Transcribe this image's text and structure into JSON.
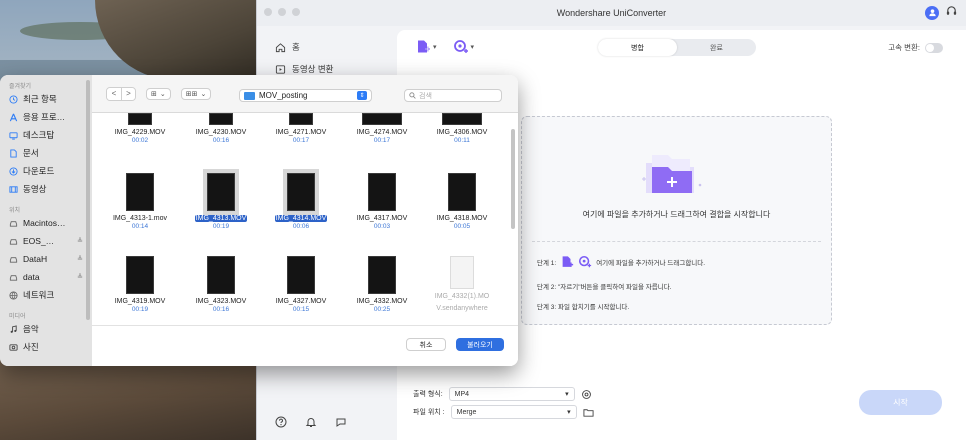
{
  "app": {
    "title": "Wondershare UniConverter",
    "sidebar": [
      {
        "label": "홈",
        "icon": "home-icon"
      },
      {
        "label": "동영상 변환",
        "icon": "convert-icon"
      }
    ],
    "bottom_icons": [
      "help-icon",
      "bell-icon",
      "feedback-icon"
    ],
    "toolbar": {
      "add_file_icon": "add-file-icon",
      "add_media_icon": "add-media-icon",
      "segments": [
        "병합",
        "완료"
      ],
      "active_segment": "병합",
      "speed_label": "고속 변환:"
    },
    "dropzone": {
      "main_text": "여기에 파일을 추가하거나 드래그하여 결합을 시작합니다",
      "step1_prefix": "단계 1:",
      "step1_text": "여기에 파일을 추가하거나 드래그합니다.",
      "step2": "단계 2: \"자르기\"버튼을 클릭하여 파일을 자릅니다.",
      "step3": "단계 3: 파일 합치기를 시작합니다."
    },
    "output": {
      "format_label": "출력 형식:",
      "format_value": "MP4",
      "location_label": "파일 위치 :",
      "location_value": "Merge"
    },
    "start_button": "시작",
    "accent_color": "#4b6ef5"
  },
  "dialog": {
    "favorites_label": "즐겨찾기",
    "favorites": [
      {
        "label": "최근 항목",
        "icon": "clock-icon"
      },
      {
        "label": "응용 프로…",
        "icon": "apps-icon"
      },
      {
        "label": "데스크탑",
        "icon": "desktop-icon"
      },
      {
        "label": "문서",
        "icon": "document-icon"
      },
      {
        "label": "다운로드",
        "icon": "download-icon"
      },
      {
        "label": "동영상",
        "icon": "film-icon"
      }
    ],
    "locations_label": "위치",
    "locations": [
      {
        "label": "Macintos…",
        "icon": "drive-icon",
        "eject": false
      },
      {
        "label": "EOS_…",
        "icon": "drive-icon",
        "eject": true
      },
      {
        "label": "DataH",
        "icon": "drive-icon",
        "eject": true
      },
      {
        "label": "data",
        "icon": "drive-icon",
        "eject": true
      },
      {
        "label": "네트워크",
        "icon": "network-icon",
        "eject": false
      }
    ],
    "media_label": "미디어",
    "media": [
      {
        "label": "음악",
        "icon": "music-icon"
      },
      {
        "label": "사진",
        "icon": "photo-icon"
      }
    ],
    "eject_symbol": "≜",
    "path": "MOV_posting",
    "search_placeholder": "검색",
    "view_icon": "⊞",
    "group_icon": "⊞⊞",
    "files": [
      {
        "name": "IMG_4229.MOV",
        "duration": "00:02"
      },
      {
        "name": "IMG_4230.MOV",
        "duration": "00:16"
      },
      {
        "name": "IMG_4271.MOV",
        "duration": "00:17"
      },
      {
        "name": "IMG_4274.MOV",
        "duration": "00:17"
      },
      {
        "name": "IMG_4306.MOV",
        "duration": "00:11"
      },
      {
        "name": "IMG_4313-1.mov",
        "duration": "00:14"
      },
      {
        "name": "IMG_4313.MOV",
        "duration": "00:19",
        "selected": true
      },
      {
        "name": "IMG_4314.MOV",
        "duration": "00:06",
        "selected": true
      },
      {
        "name": "IMG_4317.MOV",
        "duration": "00:03"
      },
      {
        "name": "IMG_4318.MOV",
        "duration": "00:05"
      },
      {
        "name": "IMG_4319.MOV",
        "duration": "00:19"
      },
      {
        "name": "IMG_4323.MOV",
        "duration": "00:16"
      },
      {
        "name": "IMG_4327.MOV",
        "duration": "00:15"
      },
      {
        "name": "IMG_4332.MOV",
        "duration": "00:25"
      }
    ],
    "doc_file": {
      "line1": "IMG_4332(1).MO",
      "line2": "V.sendanywhere"
    },
    "cancel_button": "취소",
    "open_button": "불러오기"
  }
}
